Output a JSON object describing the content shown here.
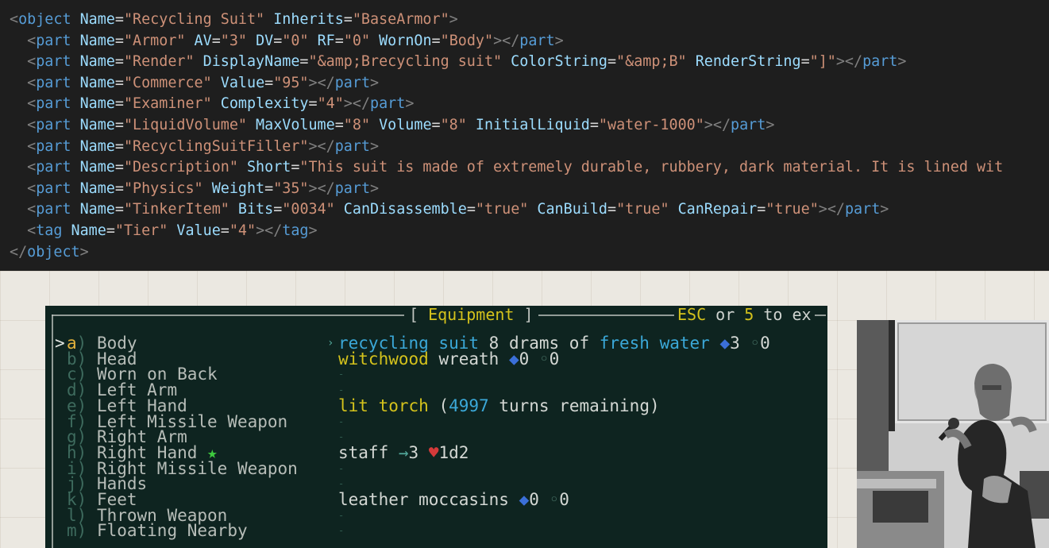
{
  "code_lines": [
    [
      [
        "<",
        "b"
      ],
      [
        "object",
        "tag"
      ],
      [
        " Name",
        "attr"
      ],
      [
        "=",
        "eq"
      ],
      [
        "\"Recycling Suit\"",
        "val"
      ],
      [
        " Inherits",
        "attr"
      ],
      [
        "=",
        "eq"
      ],
      [
        "\"BaseArmor\"",
        "val"
      ],
      [
        ">",
        "b"
      ]
    ],
    [
      [
        "  <",
        "b"
      ],
      [
        "part",
        "tag"
      ],
      [
        " Name",
        "attr"
      ],
      [
        "=",
        "eq"
      ],
      [
        "\"Armor\"",
        "val"
      ],
      [
        " AV",
        "attr"
      ],
      [
        "=",
        "eq"
      ],
      [
        "\"3\"",
        "val"
      ],
      [
        " DV",
        "attr"
      ],
      [
        "=",
        "eq"
      ],
      [
        "\"0\"",
        "val"
      ],
      [
        " RF",
        "attr"
      ],
      [
        "=",
        "eq"
      ],
      [
        "\"0\"",
        "val"
      ],
      [
        " WornOn",
        "attr"
      ],
      [
        "=",
        "eq"
      ],
      [
        "\"Body\"",
        "val"
      ],
      [
        "></",
        "b"
      ],
      [
        "part",
        "tag"
      ],
      [
        ">",
        "b"
      ]
    ],
    [
      [
        "  <",
        "b"
      ],
      [
        "part",
        "tag"
      ],
      [
        " Name",
        "attr"
      ],
      [
        "=",
        "eq"
      ],
      [
        "\"Render\"",
        "val"
      ],
      [
        " DisplayName",
        "attr"
      ],
      [
        "=",
        "eq"
      ],
      [
        "\"&amp;Brecycling suit\"",
        "val"
      ],
      [
        " ColorString",
        "attr"
      ],
      [
        "=",
        "eq"
      ],
      [
        "\"&amp;B\"",
        "val"
      ],
      [
        " RenderString",
        "attr"
      ],
      [
        "=",
        "eq"
      ],
      [
        "\"]\"",
        "val"
      ],
      [
        "></",
        "b"
      ],
      [
        "part",
        "tag"
      ],
      [
        ">",
        "b"
      ]
    ],
    [
      [
        "  <",
        "b"
      ],
      [
        "part",
        "tag"
      ],
      [
        " Name",
        "attr"
      ],
      [
        "=",
        "eq"
      ],
      [
        "\"Commerce\"",
        "val"
      ],
      [
        " Value",
        "attr"
      ],
      [
        "=",
        "eq"
      ],
      [
        "\"95\"",
        "val"
      ],
      [
        "></",
        "b"
      ],
      [
        "part",
        "tag"
      ],
      [
        ">",
        "b"
      ]
    ],
    [
      [
        "  <",
        "b"
      ],
      [
        "part",
        "tag"
      ],
      [
        " Name",
        "attr"
      ],
      [
        "=",
        "eq"
      ],
      [
        "\"Examiner\"",
        "val"
      ],
      [
        " Complexity",
        "attr"
      ],
      [
        "=",
        "eq"
      ],
      [
        "\"4\"",
        "val"
      ],
      [
        "></",
        "b"
      ],
      [
        "part",
        "tag"
      ],
      [
        ">",
        "b"
      ]
    ],
    [
      [
        "  <",
        "b"
      ],
      [
        "part",
        "tag"
      ],
      [
        " Name",
        "attr"
      ],
      [
        "=",
        "eq"
      ],
      [
        "\"LiquidVolume\"",
        "val"
      ],
      [
        " MaxVolume",
        "attr"
      ],
      [
        "=",
        "eq"
      ],
      [
        "\"8\"",
        "val"
      ],
      [
        " Volume",
        "attr"
      ],
      [
        "=",
        "eq"
      ],
      [
        "\"8\"",
        "val"
      ],
      [
        " InitialLiquid",
        "attr"
      ],
      [
        "=",
        "eq"
      ],
      [
        "\"water-1000\"",
        "val"
      ],
      [
        "></",
        "b"
      ],
      [
        "part",
        "tag"
      ],
      [
        ">",
        "b"
      ]
    ],
    [
      [
        "  <",
        "b"
      ],
      [
        "part",
        "tag"
      ],
      [
        " Name",
        "attr"
      ],
      [
        "=",
        "eq"
      ],
      [
        "\"RecyclingSuitFiller\"",
        "val"
      ],
      [
        "></",
        "b"
      ],
      [
        "part",
        "tag"
      ],
      [
        ">",
        "b"
      ]
    ],
    [
      [
        "  <",
        "b"
      ],
      [
        "part",
        "tag"
      ],
      [
        " Name",
        "attr"
      ],
      [
        "=",
        "eq"
      ],
      [
        "\"Description\"",
        "val"
      ],
      [
        " Short",
        "attr"
      ],
      [
        "=",
        "eq"
      ],
      [
        "\"This suit is made of extremely durable, rubbery, dark material. It is lined wit",
        "val"
      ]
    ],
    [
      [
        "  <",
        "b"
      ],
      [
        "part",
        "tag"
      ],
      [
        " Name",
        "attr"
      ],
      [
        "=",
        "eq"
      ],
      [
        "\"Physics\"",
        "val"
      ],
      [
        " Weight",
        "attr"
      ],
      [
        "=",
        "eq"
      ],
      [
        "\"35\"",
        "val"
      ],
      [
        "></",
        "b"
      ],
      [
        "part",
        "tag"
      ],
      [
        ">",
        "b"
      ]
    ],
    [
      [
        "  <",
        "b"
      ],
      [
        "part",
        "tag"
      ],
      [
        " Name",
        "attr"
      ],
      [
        "=",
        "eq"
      ],
      [
        "\"TinkerItem\"",
        "val"
      ],
      [
        " Bits",
        "attr"
      ],
      [
        "=",
        "eq"
      ],
      [
        "\"0034\"",
        "val"
      ],
      [
        " CanDisassemble",
        "attr"
      ],
      [
        "=",
        "eq"
      ],
      [
        "\"true\"",
        "val"
      ],
      [
        " CanBuild",
        "attr"
      ],
      [
        "=",
        "eq"
      ],
      [
        "\"true\"",
        "val"
      ],
      [
        " CanRepair",
        "attr"
      ],
      [
        "=",
        "eq"
      ],
      [
        "\"true\"",
        "val"
      ],
      [
        "></",
        "b"
      ],
      [
        "part",
        "tag"
      ],
      [
        ">",
        "b"
      ]
    ],
    [
      [
        "  <",
        "b"
      ],
      [
        "tag",
        "tag"
      ],
      [
        " Name",
        "attr"
      ],
      [
        "=",
        "eq"
      ],
      [
        "\"Tier\"",
        "val"
      ],
      [
        " Value",
        "attr"
      ],
      [
        "=",
        "eq"
      ],
      [
        "\"4\"",
        "val"
      ],
      [
        "></",
        "b"
      ],
      [
        "tag",
        "tag"
      ],
      [
        ">",
        "b"
      ]
    ],
    [
      [
        "</",
        "b"
      ],
      [
        "object",
        "tag"
      ],
      [
        ">",
        "b"
      ]
    ]
  ],
  "game": {
    "title_left": "[",
    "title": "Equipment",
    "title_right": "]",
    "esc_pre": "ESC",
    "esc_or": " or ",
    "esc_key": "5",
    "esc_post": " to ex",
    "cursor": ">",
    "slots": [
      {
        "key": "a",
        "name": "Body"
      },
      {
        "key": "b",
        "name": "Head"
      },
      {
        "key": "c",
        "name": "Worn on Back"
      },
      {
        "key": "d",
        "name": "Left Arm"
      },
      {
        "key": "e",
        "name": "Left Hand"
      },
      {
        "key": "f",
        "name": "Left Missile Weapon"
      },
      {
        "key": "g",
        "name": "Right Arm"
      },
      {
        "key": "h",
        "name": "Right Hand"
      },
      {
        "key": "i",
        "name": "Right Missile Weapon"
      },
      {
        "key": "j",
        "name": "Hands"
      },
      {
        "key": "k",
        "name": "Feet"
      },
      {
        "key": "l",
        "name": "Thrown Weapon"
      },
      {
        "key": "m",
        "name": "Floating Nearby"
      }
    ],
    "primary_star": "★",
    "items": {
      "body": [
        [
          "recycling suit",
          "cyan"
        ],
        [
          " 8 drams of ",
          "wht"
        ],
        [
          "fresh water",
          "cyan"
        ],
        [
          " ",
          "wht"
        ],
        [
          "◆",
          "bluedot"
        ],
        [
          "3 ",
          "wht"
        ],
        [
          "◦",
          "dim"
        ],
        [
          "0",
          "wht"
        ]
      ],
      "head": [
        [
          "witchwood",
          "yel"
        ],
        [
          " wreath ",
          "wht"
        ],
        [
          "◆",
          "bluedot"
        ],
        [
          "0 ",
          "wht"
        ],
        [
          "◦",
          "dim"
        ],
        [
          "0",
          "wht"
        ]
      ],
      "left_hand": [
        [
          "lit torch",
          "yel"
        ],
        [
          " (",
          "wht"
        ],
        [
          "4997",
          "cyan"
        ],
        [
          " turns remaining)",
          "wht"
        ]
      ],
      "right_hand": [
        [
          "staff ",
          "wht"
        ],
        [
          "→",
          "arr"
        ],
        [
          "3 ",
          "wht"
        ],
        [
          "♥",
          "heart"
        ],
        [
          "1d2",
          "wht"
        ]
      ],
      "feet": [
        [
          "leather moccasins ",
          "wht"
        ],
        [
          "◆",
          "bluedot"
        ],
        [
          "0 ",
          "wht"
        ],
        [
          "◦",
          "dim"
        ],
        [
          "0",
          "wht"
        ]
      ]
    },
    "empty": "-"
  },
  "colors": {
    "code_bg": "#1e1e1e",
    "game_bg": "#0e2420",
    "tag": "#569cd6",
    "attr": "#9cdcfe",
    "value": "#ce9178"
  }
}
